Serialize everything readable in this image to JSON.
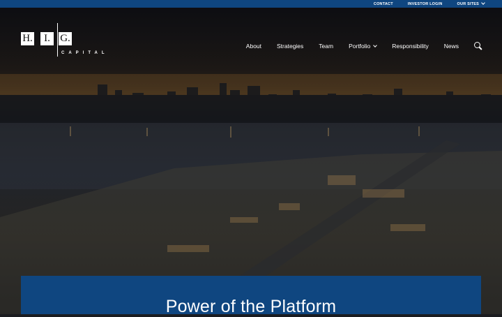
{
  "topbar": {
    "links": [
      "CONTACT",
      "INVESTOR LOGIN",
      "OUR SITES"
    ]
  },
  "logo": {
    "letters": [
      "H.",
      "I.",
      "G."
    ],
    "tagline": "CAPITAL"
  },
  "nav": {
    "items": [
      "About",
      "Strategies",
      "Team",
      "Portfolio",
      "Responsibility",
      "News"
    ]
  },
  "hero": {
    "panel_title": "Power of the Platform"
  },
  "colors": {
    "brand_blue": "#0f4680",
    "text": "#ffffff"
  },
  "icons": {
    "search": "search-icon",
    "dropdown": "chevron-down-icon"
  }
}
